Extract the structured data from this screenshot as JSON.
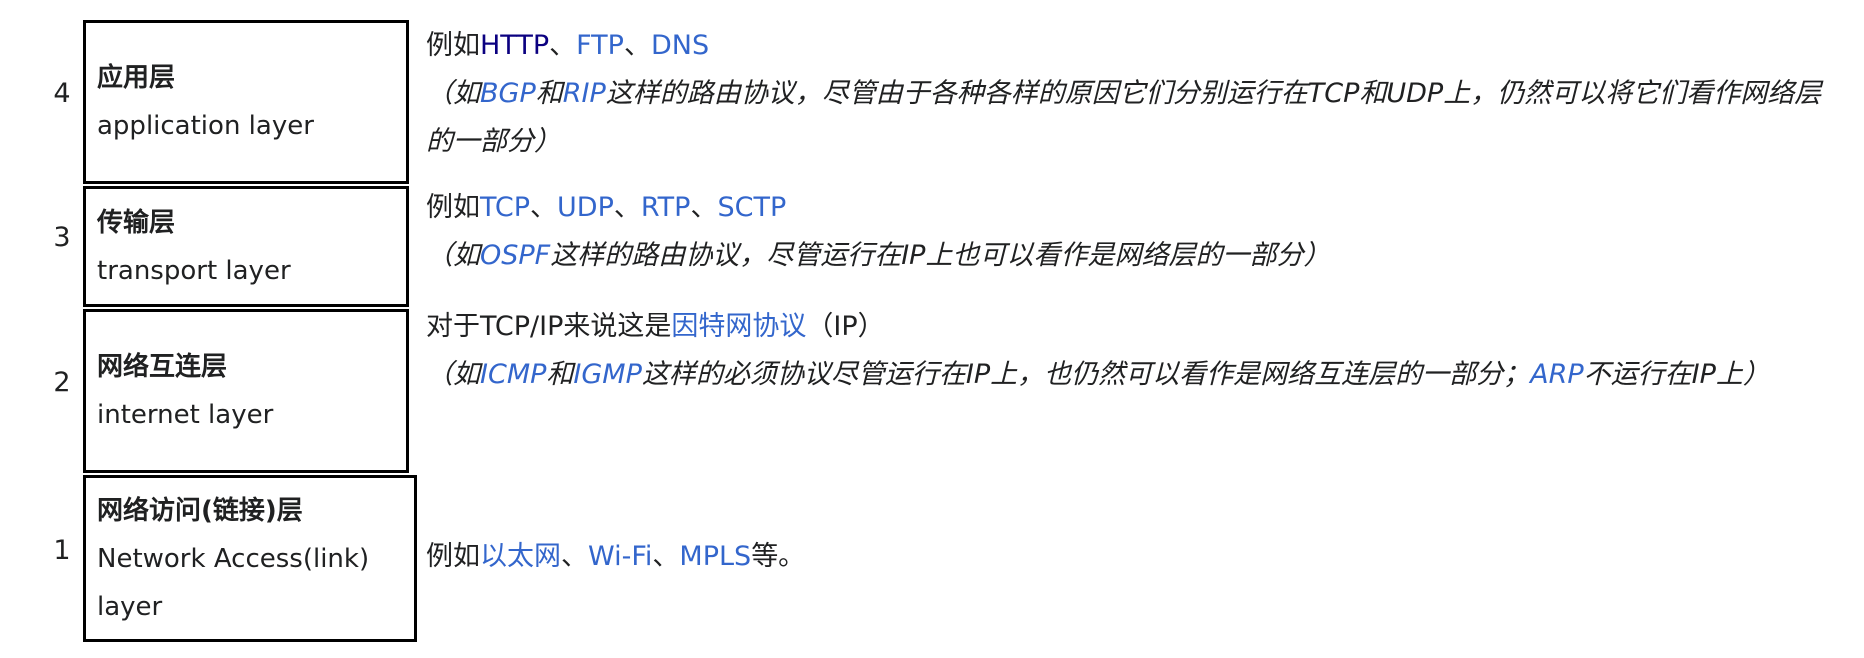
{
  "colors": {
    "link": "#3366cc",
    "visited_link": "#0b0080",
    "text": "#202122"
  },
  "rows": [
    {
      "num": "4",
      "zh": "应用层",
      "en": "application layer",
      "line1": [
        {
          "t": "例如"
        },
        {
          "t": "HTTP",
          "link": "visited"
        },
        {
          "t": "、"
        },
        {
          "t": "FTP",
          "link": "link"
        },
        {
          "t": "、"
        },
        {
          "t": "DNS",
          "link": "link"
        }
      ],
      "line2": [
        {
          "t": "（如"
        },
        {
          "t": "BGP",
          "link": "link"
        },
        {
          "t": "和"
        },
        {
          "t": "RIP",
          "link": "link"
        },
        {
          "t": "这样的路由协议，尽管由于各种各样的原因它们分别运行在TCP和UDP上，仍然可以将它们看作网络层的一部分）"
        }
      ]
    },
    {
      "num": "3",
      "zh": "传输层",
      "en": "transport layer",
      "line1": [
        {
          "t": "例如"
        },
        {
          "t": "TCP",
          "link": "link"
        },
        {
          "t": "、"
        },
        {
          "t": "UDP",
          "link": "link"
        },
        {
          "t": "、"
        },
        {
          "t": "RTP",
          "link": "link"
        },
        {
          "t": "、"
        },
        {
          "t": "SCTP",
          "link": "link"
        }
      ],
      "line2": [
        {
          "t": "（如"
        },
        {
          "t": "OSPF",
          "link": "link"
        },
        {
          "t": "这样的路由协议，尽管运行在IP上也可以看作是网络层的一部分）"
        }
      ]
    },
    {
      "num": "2",
      "zh": "网络互连层",
      "en": "internet layer",
      "line1": [
        {
          "t": "对于TCP/IP来说这是"
        },
        {
          "t": "因特网协议",
          "link": "link"
        },
        {
          "t": "（IP）"
        }
      ],
      "line2": [
        {
          "t": "（如"
        },
        {
          "t": "ICMP",
          "link": "link"
        },
        {
          "t": "和"
        },
        {
          "t": "IGMP",
          "link": "link"
        },
        {
          "t": "这样的必须协议尽管运行在IP上，也仍然可以看作是网络互连层的一部分；"
        },
        {
          "t": "ARP",
          "link": "link"
        },
        {
          "t": "不运行在IP上）"
        }
      ]
    },
    {
      "num": "1",
      "zh": "网络访问(链接)层",
      "en": "Network Access(link) layer",
      "line1": [
        {
          "t": "例如"
        },
        {
          "t": "以太网",
          "link": "link"
        },
        {
          "t": "、"
        },
        {
          "t": "Wi-Fi",
          "link": "link"
        },
        {
          "t": "、"
        },
        {
          "t": "MPLS",
          "link": "link"
        },
        {
          "t": "等。"
        }
      ],
      "line2": []
    }
  ]
}
